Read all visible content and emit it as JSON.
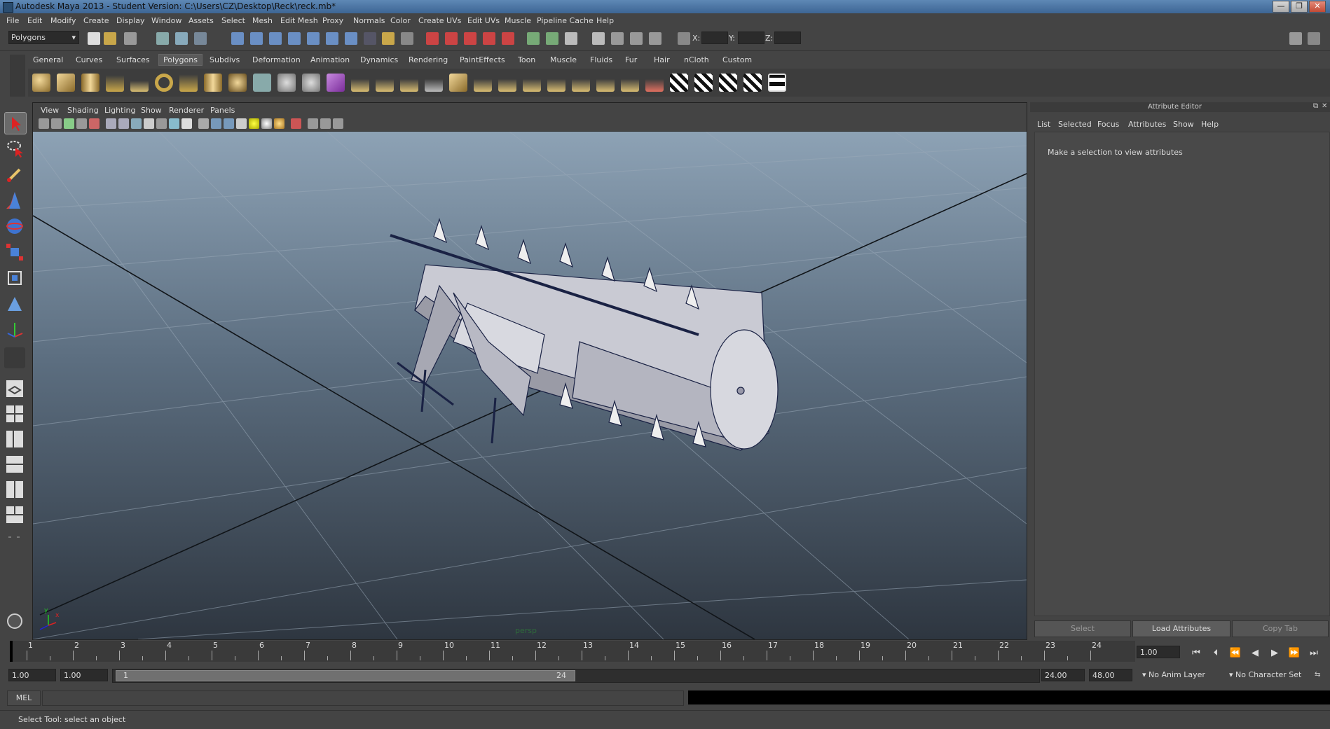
{
  "title": "Autodesk Maya 2013 - Student Version: C:\\Users\\CZ\\Desktop\\Reck\\reck.mb*",
  "window_buttons": [
    "—",
    "❐",
    "✕"
  ],
  "menubar": [
    "File",
    "Edit",
    "Modify",
    "Create",
    "Display",
    "Window",
    "Assets",
    "Select",
    "Mesh",
    "Edit Mesh",
    "Proxy",
    "Normals",
    "Color",
    "Create UVs",
    "Edit UVs",
    "Muscle",
    "Pipeline Cache",
    "Help"
  ],
  "status_line": {
    "menu_set": "Polygons",
    "x_label": "X:",
    "y_label": "Y:",
    "z_label": "Z:"
  },
  "shelf_tabs": [
    "General",
    "Curves",
    "Surfaces",
    "Polygons",
    "Subdivs",
    "Deformation",
    "Animation",
    "Dynamics",
    "Rendering",
    "PaintEffects",
    "Toon",
    "Muscle",
    "Fluids",
    "Fur",
    "Hair",
    "nCloth",
    "Custom"
  ],
  "shelf_active": "Polygons",
  "viewport": {
    "menu": [
      "View",
      "Shading",
      "Lighting",
      "Show",
      "Renderer",
      "Panels"
    ],
    "camera_label": "persp",
    "axis_x": "x",
    "axis_y": "y"
  },
  "attribute_editor": {
    "title": "Attribute Editor",
    "menu": [
      "List",
      "Selected",
      "Focus",
      "Attributes",
      "Show",
      "Help"
    ],
    "message": "Make a selection to view attributes",
    "buttons": [
      "Select",
      "Load Attributes",
      "Copy Tab"
    ]
  },
  "time_slider": {
    "frames": [
      "1",
      "2",
      "3",
      "4",
      "5",
      "6",
      "7",
      "8",
      "9",
      "10",
      "11",
      "12",
      "13",
      "14",
      "15",
      "16",
      "17",
      "18",
      "19",
      "20",
      "21",
      "22",
      "23",
      "24"
    ],
    "current_time": "1.00"
  },
  "range_slider": {
    "start": "1.00",
    "playback_start": "1.00",
    "range_min": "1",
    "range_max": "24",
    "playback_end": "24.00",
    "end": "48.00",
    "anim_layer": "No Anim Layer",
    "character_set": "No Character Set"
  },
  "command_line": {
    "label": "MEL"
  },
  "help_line": "Select Tool: select an object",
  "colors": {
    "accent": "#5a5a5a",
    "viewport_top": "#8da2b5",
    "viewport_bottom": "#2e3640",
    "model": "#c9cad3",
    "wire": "#1a2244"
  }
}
